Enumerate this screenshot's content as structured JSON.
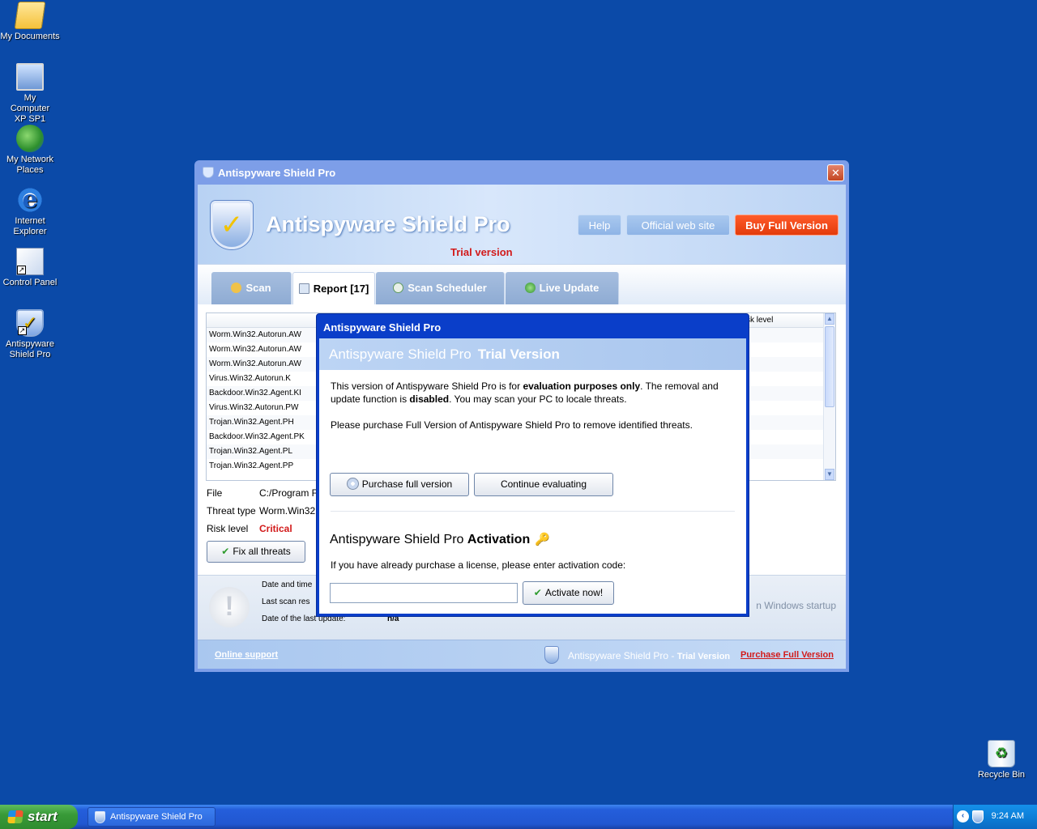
{
  "desktop": {
    "icons": [
      {
        "label": "My Documents",
        "icon": "folder-icon"
      },
      {
        "label": "My Computer XP SP1",
        "icon": "computer-icon"
      },
      {
        "label": "My Network Places",
        "icon": "network-icon"
      },
      {
        "label": "Internet Explorer",
        "icon": "ie-icon"
      },
      {
        "label": "Control Panel",
        "icon": "control-panel-icon"
      },
      {
        "label": "Antispyware Shield Pro",
        "icon": "shield-icon"
      },
      {
        "label": "Recycle Bin",
        "icon": "recycle-bin-icon"
      }
    ]
  },
  "window": {
    "title": "Antispyware Shield Pro",
    "close_glyph": "✕",
    "header": {
      "product_name": "Antispyware Shield Pro",
      "trial_label": "Trial version",
      "help_label": "Help",
      "website_label": "Official web site",
      "buy_label": "Buy Full Version"
    },
    "tabs": [
      {
        "label": "Scan"
      },
      {
        "label": "Report [17]"
      },
      {
        "label": "Scan Scheduler"
      },
      {
        "label": "Live Update"
      }
    ],
    "report": {
      "column_risk": "sk level",
      "threats": [
        "Worm.Win32.Autorun.AW",
        "Worm.Win32.Autorun.AW",
        "Worm.Win32.Autorun.AW",
        "Virus.Win32.Autorun.K",
        "Backdoor.Win32.Agent.KI",
        "Virus.Win32.Autorun.PW",
        "Trojan.Win32.Agent.PH",
        "Backdoor.Win32.Agent.PK",
        "Trojan.Win32.Agent.PL",
        "Trojan.Win32.Agent.PP"
      ],
      "file_label": "File",
      "file_value": "C:/Program F",
      "threat_type_label": "Threat type",
      "threat_type_value": "Worm.Win32",
      "risk_label": "Risk level",
      "risk_value": "Critical",
      "fix_label": "Fix all threats"
    },
    "status": {
      "date_time_label": "Date and time",
      "last_scan_label": "Last scan res",
      "last_update_label": "Date of the last update:",
      "last_update_value": "n/a",
      "startup_text": "n Windows startup"
    },
    "footer": {
      "online_support": "Online support",
      "brand": "Antispyware Shield Pro",
      "brand_sep": " - ",
      "trial": "Trial Version",
      "buy_link": "Purchase Full Version"
    }
  },
  "dialog": {
    "title": "Antispyware Shield Pro",
    "header_name": "Antispyware Shield Pro",
    "header_trial": "Trial Version",
    "para1_a": "This version of Antispyware Shield Pro is for ",
    "para1_b": "evaluation purposes only",
    "para1_c": ". The removal and update function is ",
    "para1_d": "disabled",
    "para1_e": ". You may scan your PC to locale threats.",
    "para2": "Please purchase Full Version of Antispyware Shield Pro to remove identified threats.",
    "purchase_label": "Purchase full version",
    "continue_label": "Continue evaluating",
    "activation_name": "Antispyware Shield Pro",
    "activation_bold": "Activation",
    "activation_text": "If you have already purchase a license, please enter activation code:",
    "activation_value": "",
    "activate_label": "Activate now!"
  },
  "taskbar": {
    "start_label": "start",
    "task_label": "Antispyware Shield Pro",
    "clock": "9:24 AM"
  },
  "colors": {
    "desktop": "#0b4aa8",
    "accent_red": "#d21a1a",
    "buy_orange": "#e33b0b"
  }
}
